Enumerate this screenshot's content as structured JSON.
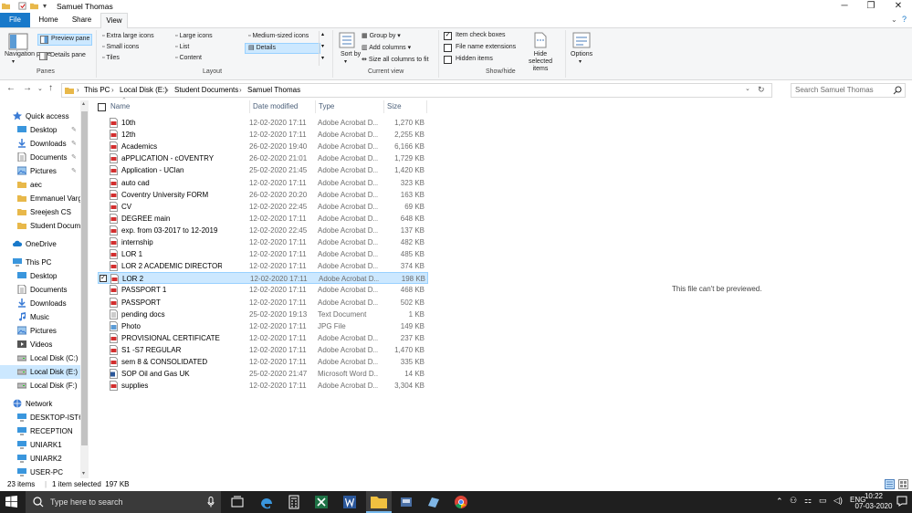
{
  "window": {
    "title": "Samuel Thomas"
  },
  "tabs": [
    {
      "label": "File"
    },
    {
      "label": "Home"
    },
    {
      "label": "Share"
    },
    {
      "label": "View"
    }
  ],
  "ribbon": {
    "panes": {
      "navigation_pane": "Navigation pane",
      "preview_pane": "Preview pane",
      "details_pane": "Details pane",
      "group": "Panes"
    },
    "layout": {
      "items": [
        "Extra large icons",
        "Large icons",
        "Medium-sized icons",
        "Small icons",
        "List",
        "Details",
        "Tiles",
        "Content"
      ],
      "group": "Layout"
    },
    "current_view": {
      "sort_by": "Sort by",
      "group_by": "Group by",
      "add_columns": "Add columns",
      "size_all": "Size all columns to fit",
      "group": "Current view"
    },
    "show_hide": {
      "item_check_boxes": "Item check boxes",
      "file_name_extensions": "File name extensions",
      "hidden_items": "Hidden items",
      "hide_selected": "Hide selected items",
      "group": "Show/hide"
    },
    "options": "Options"
  },
  "address": {
    "crumbs": [
      "This PC",
      "Local Disk (E:)",
      "Student Documents",
      "Samuel Thomas"
    ],
    "search_placeholder": "Search Samuel Thomas"
  },
  "nav": {
    "items": [
      {
        "label": "Quick access",
        "kind": "star",
        "top": true
      },
      {
        "label": "Desktop",
        "kind": "desktop",
        "pin": true
      },
      {
        "label": "Downloads",
        "kind": "download",
        "pin": true
      },
      {
        "label": "Documents",
        "kind": "doc",
        "pin": true
      },
      {
        "label": "Pictures",
        "kind": "pic",
        "pin": true
      },
      {
        "label": "aec",
        "kind": "folder"
      },
      {
        "label": "Emmanuel Vargh",
        "kind": "folder"
      },
      {
        "label": "Sreejesh CS",
        "kind": "folder"
      },
      {
        "label": "Student Docume",
        "kind": "folder"
      },
      {
        "label": "OneDrive",
        "kind": "cloud",
        "top": true
      },
      {
        "label": "This PC",
        "kind": "pc",
        "top": true
      },
      {
        "label": "Desktop",
        "kind": "desktop"
      },
      {
        "label": "Documents",
        "kind": "doc"
      },
      {
        "label": "Downloads",
        "kind": "download"
      },
      {
        "label": "Music",
        "kind": "music"
      },
      {
        "label": "Pictures",
        "kind": "pic"
      },
      {
        "label": "Videos",
        "kind": "video"
      },
      {
        "label": "Local Disk (C:)",
        "kind": "drive"
      },
      {
        "label": "Local Disk (E:)",
        "kind": "drive",
        "sel": true
      },
      {
        "label": "Local Disk (F:)",
        "kind": "drive"
      },
      {
        "label": "Network",
        "kind": "network",
        "top": true
      },
      {
        "label": "DESKTOP-IST6V8",
        "kind": "computer"
      },
      {
        "label": "RECEPTION",
        "kind": "computer"
      },
      {
        "label": "UNIARK1",
        "kind": "computer"
      },
      {
        "label": "UNIARK2",
        "kind": "computer"
      },
      {
        "label": "USER-PC",
        "kind": "computer"
      }
    ]
  },
  "columns": {
    "name": "Name",
    "date": "Date modified",
    "type": "Type",
    "size": "Size"
  },
  "files": [
    {
      "name": "10th",
      "date": "12-02-2020 17:11",
      "type": "Adobe Acrobat D...",
      "size": "1,270 KB",
      "icon": "pdf"
    },
    {
      "name": "12th",
      "date": "12-02-2020 17:11",
      "type": "Adobe Acrobat D...",
      "size": "2,255 KB",
      "icon": "pdf"
    },
    {
      "name": "Academics",
      "date": "26-02-2020 19:40",
      "type": "Adobe Acrobat D...",
      "size": "6,166 KB",
      "icon": "pdf"
    },
    {
      "name": "aPPLICATION - cOVENTRY",
      "date": "26-02-2020 21:01",
      "type": "Adobe Acrobat D...",
      "size": "1,729 KB",
      "icon": "pdf"
    },
    {
      "name": "Application - UClan",
      "date": "25-02-2020 21:45",
      "type": "Adobe Acrobat D...",
      "size": "1,420 KB",
      "icon": "pdf"
    },
    {
      "name": "auto cad",
      "date": "12-02-2020 17:11",
      "type": "Adobe Acrobat D...",
      "size": "323 KB",
      "icon": "pdf"
    },
    {
      "name": "Coventry University FORM",
      "date": "26-02-2020 20:20",
      "type": "Adobe Acrobat D...",
      "size": "163 KB",
      "icon": "pdf"
    },
    {
      "name": "CV",
      "date": "12-02-2020 22:45",
      "type": "Adobe Acrobat D...",
      "size": "69 KB",
      "icon": "pdf"
    },
    {
      "name": "DEGREE main",
      "date": "12-02-2020 17:11",
      "type": "Adobe Acrobat D...",
      "size": "648 KB",
      "icon": "pdf"
    },
    {
      "name": "exp. from 03-2017 to 12-2019",
      "date": "12-02-2020 22:45",
      "type": "Adobe Acrobat D...",
      "size": "137 KB",
      "icon": "pdf"
    },
    {
      "name": "internship",
      "date": "12-02-2020 17:11",
      "type": "Adobe Acrobat D...",
      "size": "482 KB",
      "icon": "pdf"
    },
    {
      "name": "LOR 1",
      "date": "12-02-2020 17:11",
      "type": "Adobe Acrobat D...",
      "size": "485 KB",
      "icon": "pdf"
    },
    {
      "name": "LOR 2 ACADEMIC DIRECTOR",
      "date": "12-02-2020 17:11",
      "type": "Adobe Acrobat D...",
      "size": "374 KB",
      "icon": "pdf"
    },
    {
      "name": "LOR 2",
      "date": "12-02-2020 17:11",
      "type": "Adobe Acrobat D...",
      "size": "198 KB",
      "icon": "pdf",
      "sel": true
    },
    {
      "name": "PASSPORT 1",
      "date": "12-02-2020 17:11",
      "type": "Adobe Acrobat D...",
      "size": "468 KB",
      "icon": "pdf"
    },
    {
      "name": "PASSPORT",
      "date": "12-02-2020 17:11",
      "type": "Adobe Acrobat D...",
      "size": "502 KB",
      "icon": "pdf"
    },
    {
      "name": "pending docs",
      "date": "25-02-2020 19:13",
      "type": "Text Document",
      "size": "1 KB",
      "icon": "txt"
    },
    {
      "name": "Photo",
      "date": "12-02-2020 17:11",
      "type": "JPG File",
      "size": "149 KB",
      "icon": "jpg"
    },
    {
      "name": "PROVISIONAL CERTIFICATE",
      "date": "12-02-2020 17:11",
      "type": "Adobe Acrobat D...",
      "size": "237 KB",
      "icon": "pdf"
    },
    {
      "name": "S1 -S7 REGULAR",
      "date": "12-02-2020 17:11",
      "type": "Adobe Acrobat D...",
      "size": "1,470 KB",
      "icon": "pdf"
    },
    {
      "name": "sem 8 & CONSOLIDATED",
      "date": "12-02-2020 17:11",
      "type": "Adobe Acrobat D...",
      "size": "335 KB",
      "icon": "pdf"
    },
    {
      "name": "SOP Oil and Gas UK",
      "date": "25-02-2020 21:47",
      "type": "Microsoft Word D...",
      "size": "14 KB",
      "icon": "word"
    },
    {
      "name": "supplies",
      "date": "12-02-2020 17:11",
      "type": "Adobe Acrobat D...",
      "size": "3,304 KB",
      "icon": "pdf"
    }
  ],
  "preview": {
    "message": "This file can't be previewed."
  },
  "status": {
    "count": "23 items",
    "selected": "1 item selected  197 KB"
  },
  "taskbar": {
    "search_placeholder": "Type here to search",
    "time": "10:22",
    "date": "07-03-2020"
  },
  "colors": {
    "accent": "#1979ca",
    "selection": "#cce8ff",
    "taskbar": "#1f1f1f"
  }
}
